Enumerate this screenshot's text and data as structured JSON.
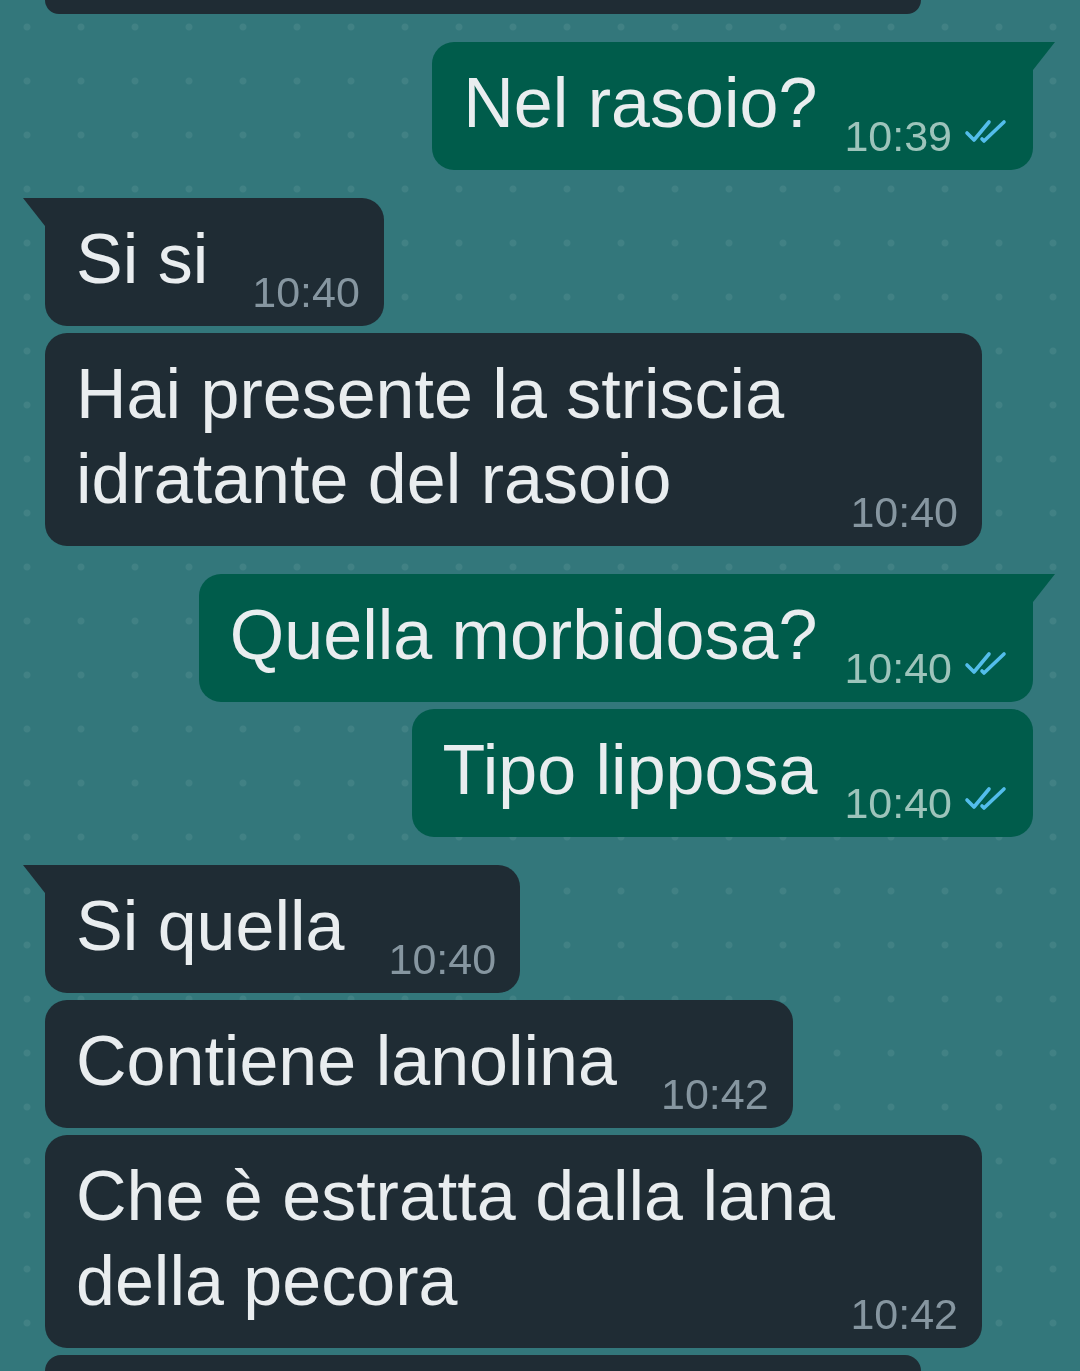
{
  "messages": [
    {
      "kind": "partial"
    },
    {
      "kind": "outgoing",
      "text": "Nel rasoio?",
      "time": "10:39",
      "read": true
    },
    {
      "kind": "incoming",
      "text": "Si si",
      "time": "10:40"
    },
    {
      "kind": "incoming",
      "text": "Hai presente la striscia idratante del rasoio",
      "time": "10:40"
    },
    {
      "kind": "outgoing",
      "text": "Quella morbidosa?",
      "time": "10:40",
      "read": true
    },
    {
      "kind": "outgoing",
      "text": "Tipo lipposa",
      "time": "10:40",
      "read": true
    },
    {
      "kind": "incoming",
      "text": "Si quella",
      "time": "10:40"
    },
    {
      "kind": "incoming",
      "text": "Contiene lanolina",
      "time": "10:42"
    },
    {
      "kind": "incoming",
      "text": "Che è estratta dalla lana della pecora",
      "time": "10:42"
    },
    {
      "kind": "partial"
    }
  ]
}
